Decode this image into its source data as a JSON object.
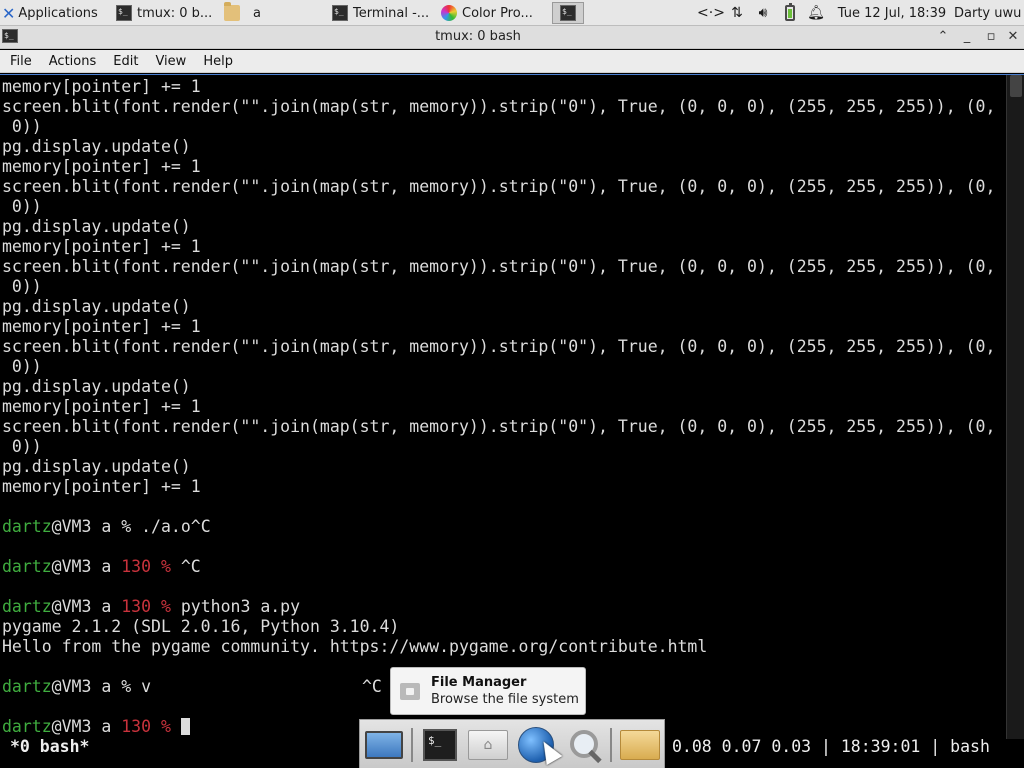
{
  "top_panel": {
    "applications_label": "Applications",
    "tasks": [
      {
        "label": "tmux: 0 b...",
        "icon": "terminal-icon"
      },
      {
        "label": "a",
        "icon": "folder-icon"
      },
      {
        "label": "Terminal -...",
        "icon": "terminal-icon"
      },
      {
        "label": "Color Pro...",
        "icon": "color-picker-icon"
      },
      {
        "label": "",
        "icon": "terminal-icon"
      }
    ],
    "clock": "Tue 12 Jul, 18:39",
    "user": "Darty uwu"
  },
  "window": {
    "title": "tmux: 0 bash"
  },
  "menu": [
    "File",
    "Actions",
    "Edit",
    "View",
    "Help"
  ],
  "terminal": {
    "lines": [
      {
        "t": "memory[pointer] += 1"
      },
      {
        "t": "screen.blit(font.render(\"\".join(map(str, memory)).strip(\"0\"), True, (0, 0, 0), (255, 255, 255)), (0,"
      },
      {
        "t": " 0))"
      },
      {
        "t": "pg.display.update()"
      },
      {
        "t": "memory[pointer] += 1"
      },
      {
        "t": "screen.blit(font.render(\"\".join(map(str, memory)).strip(\"0\"), True, (0, 0, 0), (255, 255, 255)), (0,"
      },
      {
        "t": " 0))"
      },
      {
        "t": "pg.display.update()"
      },
      {
        "t": "memory[pointer] += 1"
      },
      {
        "t": "screen.blit(font.render(\"\".join(map(str, memory)).strip(\"0\"), True, (0, 0, 0), (255, 255, 255)), (0,"
      },
      {
        "t": " 0))"
      },
      {
        "t": "pg.display.update()"
      },
      {
        "t": "memory[pointer] += 1"
      },
      {
        "t": "screen.blit(font.render(\"\".join(map(str, memory)).strip(\"0\"), True, (0, 0, 0), (255, 255, 255)), (0,"
      },
      {
        "t": " 0))"
      },
      {
        "t": "pg.display.update()"
      },
      {
        "t": "memory[pointer] += 1"
      },
      {
        "t": "screen.blit(font.render(\"\".join(map(str, memory)).strip(\"0\"), True, (0, 0, 0), (255, 255, 255)), (0,"
      },
      {
        "t": " 0))"
      },
      {
        "t": "pg.display.update()"
      },
      {
        "t": "memory[pointer] += 1"
      },
      {
        "t": ""
      },
      {
        "user": "dartz",
        "host": "@VM3 a ",
        "code": "",
        "sym": "% ",
        "cmd": "./a.o^C"
      },
      {
        "t": ""
      },
      {
        "user": "dartz",
        "host": "@VM3 a ",
        "code": "130 ",
        "sym": "% ",
        "cmd": "^C"
      },
      {
        "t": ""
      },
      {
        "user": "dartz",
        "host": "@VM3 a ",
        "code": "130 ",
        "sym": "% ",
        "cmd": "python3 a.py"
      },
      {
        "t": "pygame 2.1.2 (SDL 2.0.16, Python 3.10.4)"
      },
      {
        "t": "Hello from the pygame community. https://www.pygame.org/contribute.html"
      },
      {
        "t": ""
      },
      {
        "user": "dartz",
        "host": "@VM3 a ",
        "code": "",
        "sym": "% ",
        "cmd": "v"
      },
      {
        "t": ""
      },
      {
        "user": "dartz",
        "host": "@VM3 a ",
        "code": "130 ",
        "sym": "% ",
        "cmd": "",
        "cursor": true
      }
    ],
    "interrupt_echo": "^C",
    "status_left": "*0 bash*",
    "status_right": "0.08 0.07 0.03 | 18:39:01 | bash"
  },
  "tooltip": {
    "title": "File Manager",
    "subtitle": "Browse the file system"
  },
  "dock": {
    "items": [
      "show-desktop-icon",
      "terminal-icon",
      "home-folder-icon",
      "web-browser-icon",
      "search-icon",
      "folder-icon"
    ]
  },
  "colors": {
    "prompt_user": "#3fad3f",
    "prompt_error": "#c8323c",
    "terminal_bg": "#000000",
    "terminal_fg": "#dcdcdc"
  }
}
